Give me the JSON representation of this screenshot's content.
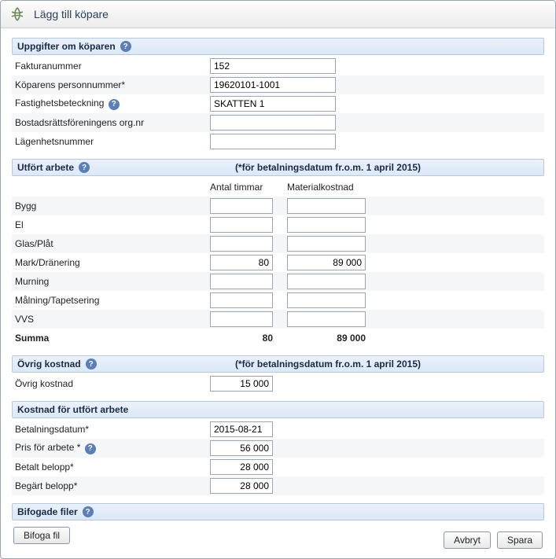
{
  "window": {
    "title": "Lägg till köpare"
  },
  "sections": {
    "buyer": {
      "heading": "Uppgifter om köparen",
      "fields": {
        "invoice_label": "Fakturanummer",
        "invoice_value": "152",
        "personnr_label": "Köparens personnummer*",
        "personnr_value": "19620101-1001",
        "fastighet_label": "Fastighetsbeteckning",
        "fastighet_value": "SKATTEN 1",
        "brf_label": "Bostadsrättsföreningens org.nr",
        "brf_value": "",
        "lgh_label": "Lägenhetsnummer",
        "lgh_value": ""
      }
    },
    "work": {
      "heading": "Utfört arbete",
      "note": "(*för betalningsdatum fr.o.m. 1 april 2015)",
      "col_hours": "Antal timmar",
      "col_material": "Materialkostnad",
      "rows": {
        "bygg": {
          "label": "Bygg",
          "hours": "",
          "material": ""
        },
        "el": {
          "label": "El",
          "hours": "",
          "material": ""
        },
        "glas": {
          "label": "Glas/Plåt",
          "hours": "",
          "material": ""
        },
        "mark": {
          "label": "Mark/Dränering",
          "hours": "80",
          "material": "89 000"
        },
        "murning": {
          "label": "Murning",
          "hours": "",
          "material": ""
        },
        "malning": {
          "label": "Målning/Tapetsering",
          "hours": "",
          "material": ""
        },
        "vvs": {
          "label": "VVS",
          "hours": "",
          "material": ""
        }
      },
      "sum_label": "Summa",
      "sum_hours": "80",
      "sum_material": "89 000"
    },
    "other": {
      "heading": "Övrig kostnad",
      "note": "(*för betalningsdatum fr.o.m. 1 april 2015)",
      "label": "Övrig kostnad",
      "value": "15 000"
    },
    "cost": {
      "heading": "Kostnad för utfört arbete",
      "date_label": "Betalningsdatum*",
      "date_value": "2015-08-21",
      "price_label": "Pris för arbete *",
      "price_value": "56 000",
      "paid_label": "Betalt belopp*",
      "paid_value": "28 000",
      "requested_label": "Begärt belopp*",
      "requested_value": "28 000"
    },
    "files": {
      "heading": "Bifogade filer",
      "attach_btn": "Bifoga fil"
    }
  },
  "footer": {
    "cancel": "Avbryt",
    "save": "Spara"
  }
}
